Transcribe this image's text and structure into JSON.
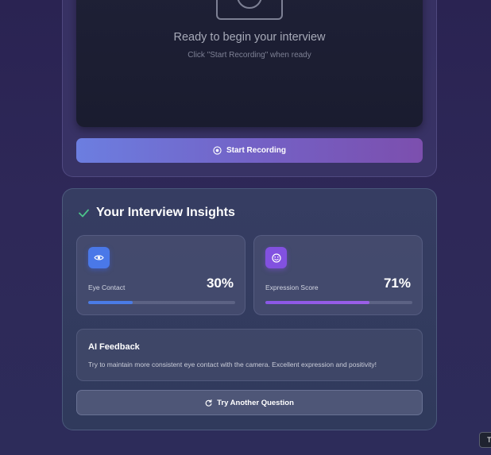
{
  "recorder": {
    "ready_title": "Ready to begin your interview",
    "ready_subtitle": "Click \"Start Recording\" when ready",
    "camera_icon": "camera-icon",
    "start_button_label": "Start Recording",
    "start_button_icon": "record-circle-icon"
  },
  "insights": {
    "title": "Your Interview Insights",
    "header_icon": "check-icon",
    "metrics": [
      {
        "label": "Eye Contact",
        "value_text": "30%",
        "value": 30,
        "icon": "eye-icon",
        "color": "#4a78e8"
      },
      {
        "label": "Expression Score",
        "value_text": "71%",
        "value": 71,
        "icon": "smile-icon",
        "color": "#8251e0"
      }
    ],
    "feedback": {
      "title": "AI Feedback",
      "text": "Try to maintain more consistent eye contact with the camera. Excellent expression and positivity!"
    },
    "retry_button_label": "Try Another Question",
    "retry_button_icon": "refresh-icon"
  },
  "corner_tag": "T",
  "colors": {
    "background": "#2a2352",
    "check_green": "#4cc38a",
    "accent_blue": "#4a78e8",
    "accent_purple": "#8251e0"
  }
}
